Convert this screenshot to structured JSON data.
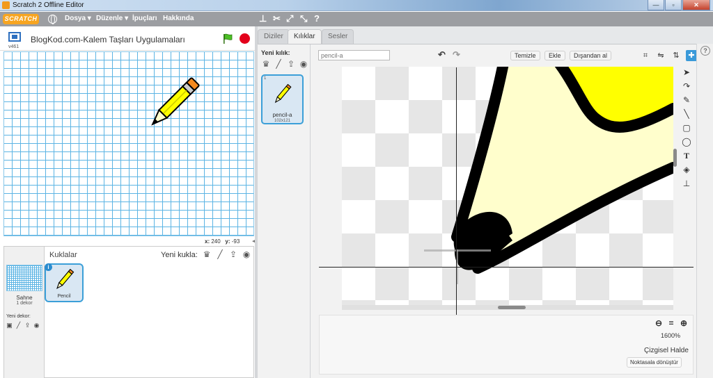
{
  "window": {
    "title": "Scratch 2 Offline Editor",
    "controls": {
      "minimize": "—",
      "maximize": "▫",
      "close": "✕"
    }
  },
  "menubar": {
    "logo": "SCRATCH",
    "items": [
      "Dosya ▾",
      "Düzenle ▾",
      "İpuçları",
      "Hakkında"
    ],
    "tool_icons": [
      "stamp-icon",
      "cut-icon",
      "grow-icon",
      "shrink-icon",
      "help-icon"
    ],
    "tool_glyphs": [
      "⊥",
      "✂",
      "⤢",
      "⤡",
      "?"
    ]
  },
  "stage": {
    "version": "v461",
    "project_title": "BlogKod.com-Kalem Taşları Uygulamaları",
    "coords": {
      "x_label": "x:",
      "x_value": "240",
      "y_label": "y:",
      "y_value": "-93"
    }
  },
  "sprites_panel": {
    "stage_label": "Sahne",
    "stage_sub": "1 dekor",
    "new_backdrop_label": "Yeni dekor:",
    "title": "Kuklalar",
    "new_sprite_label": "Yeni kukla:",
    "sprites": [
      {
        "name": "Pencil"
      }
    ]
  },
  "editor": {
    "tabs": [
      "Diziler",
      "Kılıklar",
      "Sesler"
    ],
    "active_tab": 1,
    "new_costume_label": "Yeni kılık:",
    "costumes": [
      {
        "index": "1",
        "name": "pencil-a",
        "size": "102x121"
      }
    ],
    "costume_name_value": "pencil-a",
    "buttons": {
      "clear": "Temizle",
      "add": "Ekle",
      "import": "Dışandan al"
    },
    "zoom_level": "1600%",
    "zoom_eq": "=",
    "mode_label": "Çizgisel Halde",
    "convert_button": "Noktasala dönüştür"
  },
  "colors": {
    "accent": "#3b9fd8",
    "menubar": "#9c9ea2",
    "pencil_body": "#ffff00",
    "pencil_wood": "#fffecc"
  }
}
